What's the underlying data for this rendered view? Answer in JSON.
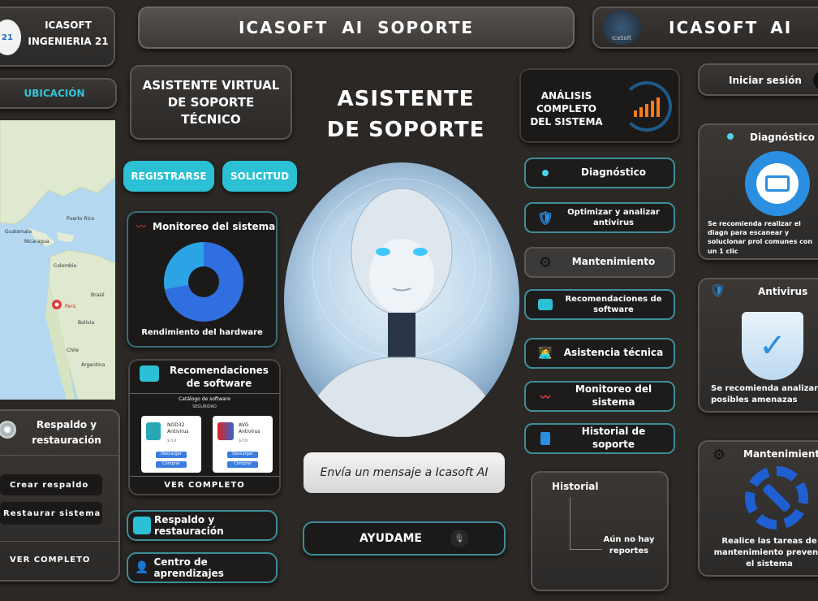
{
  "brand": {
    "line1": "ICASOFT",
    "line2": "INGENIERIA 21",
    "logo_text": "21"
  },
  "header": {
    "title": "ICASOFT AI SOPORTE",
    "brand_title": "ICASOFT AI",
    "logo_text": "IcaSoft"
  },
  "location": {
    "label": "UBICACIÓN"
  },
  "map_labels": {
    "puerto_rico": "Puerto Rico",
    "guatemala": "Guatemala",
    "nicaragua": "Nicaragua",
    "colombia": "Colombia",
    "peru": "Perú",
    "bolivia": "Bolivia",
    "chile": "Chile",
    "argentina": "Argentina",
    "brasil": "Brasil"
  },
  "assistant_card": {
    "title": "ASISTENTE VIRTUAL DE SOPORTE TÉCNICO"
  },
  "main_title": {
    "line1": "ASISTENTE",
    "line2": "DE SOPORTE"
  },
  "buttons": {
    "register": "REGISTRARSE",
    "request": "SOLICITUD",
    "login": "Iniciar sesión",
    "help": "AYUDAME"
  },
  "monitor_card": {
    "title": "Monitoreo del sistema",
    "caption": "Rendimiento del hardware",
    "usage_fraction": 0.72
  },
  "recommend_card": {
    "title": "Recomendaciones de software",
    "catalog": "Catálogo de software",
    "security": "SEGURIDAD",
    "apps": [
      {
        "name": "NOD32 Antivirus",
        "price": "$/19",
        "download": "Descargar",
        "buy": "Comprar"
      },
      {
        "name": "AVG Antivirus",
        "price": "$/19",
        "download": "Descargar",
        "buy": "Comprar"
      }
    ],
    "see_all": "VER COMPLETO"
  },
  "backup_card": {
    "title": "Respaldo y restauración",
    "create": "Crear respaldo",
    "restore": "Restaurar sistema",
    "see_all": "VER COMPLETO"
  },
  "bottom_links": {
    "backup": "Respaldo y restauración",
    "learning": "Centro de aprendizajes"
  },
  "chat": {
    "placeholder": "Envía un mensaje a Icasoft AI"
  },
  "analysis_card": {
    "title": "ANÁLISIS COMPLETO DEL SISTEMA"
  },
  "menu": {
    "diagnostic": "Diagnóstico",
    "optimize": "Optimizar y analizar antivirus",
    "maintenance": "Mantenimiento",
    "recommendations": "Recomendaciones de software",
    "assistance": "Asistencia técnica",
    "monitoring": "Monitoreo del sistema",
    "history": "Historial de soporte"
  },
  "history_card": {
    "title": "Historial",
    "empty": "Aún no hay reportes"
  },
  "diag_card": {
    "title": "Diagnóstico",
    "text": "Se recomienda realizar el diagn para escanear y solucionar prol comunes con un 1 clic"
  },
  "antivirus_card": {
    "title": "Antivirus",
    "text": "Se recomienda analizar posibles amenazas"
  },
  "maint_card": {
    "title": "Mantenimiento",
    "text": "Realice las tareas de mantenimiento preventi el sistema"
  },
  "colors": {
    "accent": "#2bc0d3",
    "bg": "#2b2826",
    "bar_orange": "#ff7a1a"
  }
}
